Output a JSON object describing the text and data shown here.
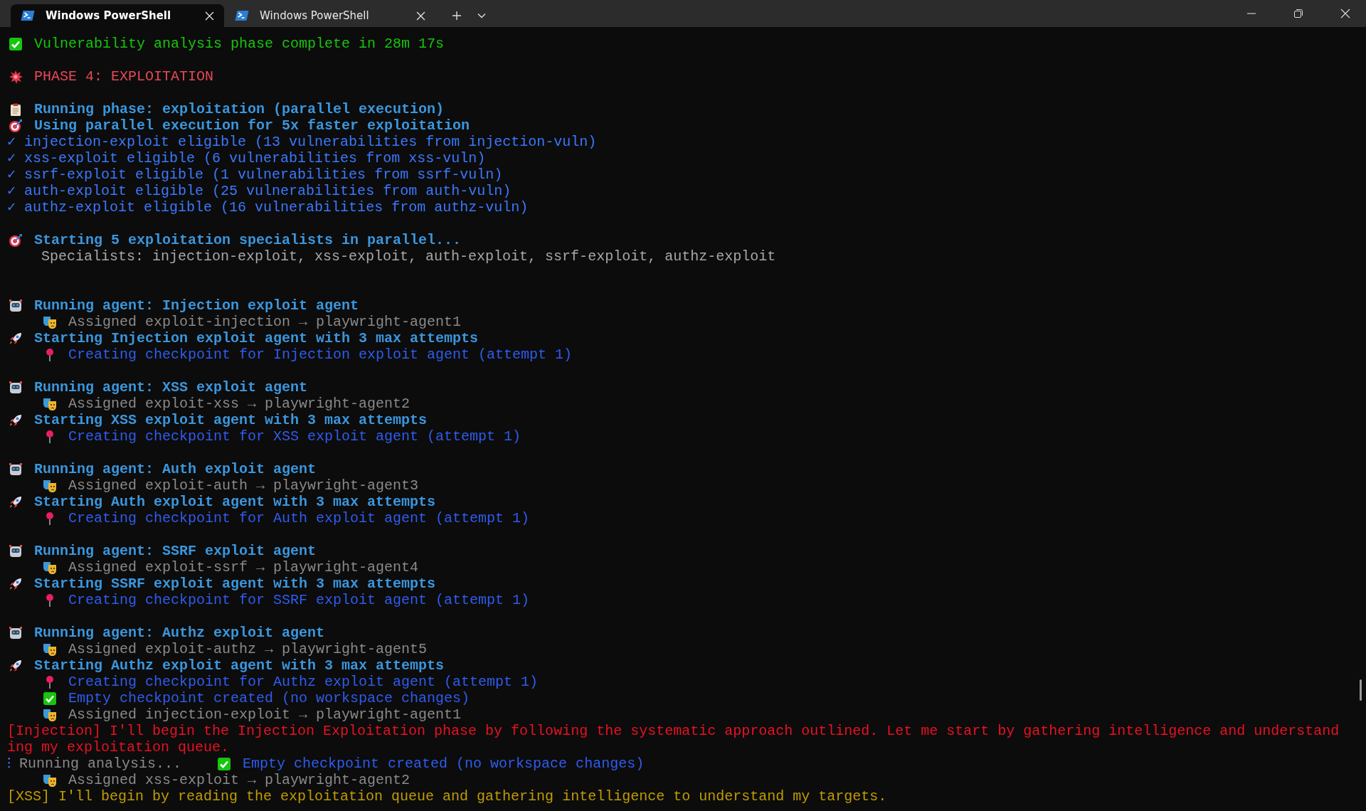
{
  "tabs": [
    {
      "title": "Windows PowerShell",
      "selected": true
    },
    {
      "title": "Windows PowerShell",
      "selected": false
    }
  ],
  "blocks": [
    {
      "lines": [
        {
          "kind": "complete",
          "text": "Vulnerability analysis phase complete in 28m 17s"
        }
      ]
    },
    {
      "lines": [
        {
          "kind": "phase",
          "text": "PHASE 4: EXPLOITATION"
        }
      ]
    },
    {
      "lines": [
        {
          "kind": "running-phase",
          "text": "Running phase: exploitation (parallel execution)"
        },
        {
          "kind": "target",
          "text": "Using parallel execution for 5x faster exploitation"
        },
        {
          "kind": "eligible",
          "mark": "✓",
          "text": "injection-exploit eligible (13 vulnerabilities from injection-vuln)"
        },
        {
          "kind": "eligible",
          "mark": "✓",
          "text": "xss-exploit eligible (6 vulnerabilities from xss-vuln)"
        },
        {
          "kind": "eligible",
          "mark": "✓",
          "text": "ssrf-exploit eligible (1 vulnerabilities from ssrf-vuln)"
        },
        {
          "kind": "eligible",
          "mark": "✓",
          "text": "auth-exploit eligible (25 vulnerabilities from auth-vuln)"
        },
        {
          "kind": "eligible",
          "mark": "✓",
          "text": "authz-exploit eligible (16 vulnerabilities from authz-vuln)"
        }
      ]
    },
    {
      "lines": [
        {
          "kind": "target",
          "text": "Starting 5 exploitation specialists in parallel..."
        },
        {
          "kind": "specialists",
          "text": "Specialists: injection-exploit, xss-exploit, auth-exploit, ssrf-exploit, authz-exploit"
        }
      ]
    },
    {
      "lines": [
        {
          "kind": "agent",
          "text": "Running agent: Injection exploit agent"
        },
        {
          "kind": "assigned",
          "text": "Assigned exploit-injection → playwright-agent1"
        },
        {
          "kind": "start",
          "text": "Starting Injection exploit agent with 3 max attempts"
        },
        {
          "kind": "checkpoint",
          "text": "Creating checkpoint for Injection exploit agent (attempt 1)"
        }
      ]
    },
    {
      "lines": [
        {
          "kind": "agent",
          "text": "Running agent: XSS exploit agent"
        },
        {
          "kind": "assigned",
          "text": "Assigned exploit-xss → playwright-agent2"
        },
        {
          "kind": "start",
          "text": "Starting XSS exploit agent with 3 max attempts"
        },
        {
          "kind": "checkpoint",
          "text": "Creating checkpoint for XSS exploit agent (attempt 1)"
        }
      ]
    },
    {
      "lines": [
        {
          "kind": "agent",
          "text": "Running agent: Auth exploit agent"
        },
        {
          "kind": "assigned",
          "text": "Assigned exploit-auth → playwright-agent3"
        },
        {
          "kind": "start",
          "text": "Starting Auth exploit agent with 3 max attempts"
        },
        {
          "kind": "checkpoint",
          "text": "Creating checkpoint for Auth exploit agent (attempt 1)"
        }
      ]
    },
    {
      "lines": [
        {
          "kind": "agent",
          "text": "Running agent: SSRF exploit agent"
        },
        {
          "kind": "assigned",
          "text": "Assigned exploit-ssrf → playwright-agent4"
        },
        {
          "kind": "start",
          "text": "Starting SSRF exploit agent with 3 max attempts"
        },
        {
          "kind": "checkpoint",
          "text": "Creating checkpoint for SSRF exploit agent (attempt 1)"
        }
      ]
    },
    {
      "lines": [
        {
          "kind": "agent",
          "text": "Running agent: Authz exploit agent"
        },
        {
          "kind": "assigned",
          "text": "Assigned exploit-authz → playwright-agent5"
        },
        {
          "kind": "start",
          "text": "Starting Authz exploit agent with 3 max attempts"
        },
        {
          "kind": "checkpoint",
          "text": "Creating checkpoint for Authz exploit agent (attempt 1)"
        },
        {
          "kind": "created",
          "text": "Empty checkpoint created (no workspace changes)"
        },
        {
          "kind": "assigned",
          "text": "Assigned injection-exploit → playwright-agent1"
        },
        {
          "kind": "log-error",
          "text": "[Injection] I'll begin the Injection Exploitation phase by following the systematic approach outlined. Let me start by gathering intelligence and understanding my exploitation queue."
        },
        {
          "kind": "status",
          "mark": "⁝",
          "text": "Running analysis...",
          "note": "Empty checkpoint created (no workspace changes)"
        },
        {
          "kind": "assigned",
          "text": "Assigned xss-exploit → playwright-agent2"
        },
        {
          "kind": "log-warn",
          "text": "[XSS] I'll begin by reading the exploitation queue and gathering intelligence to understand my targets."
        }
      ]
    }
  ]
}
